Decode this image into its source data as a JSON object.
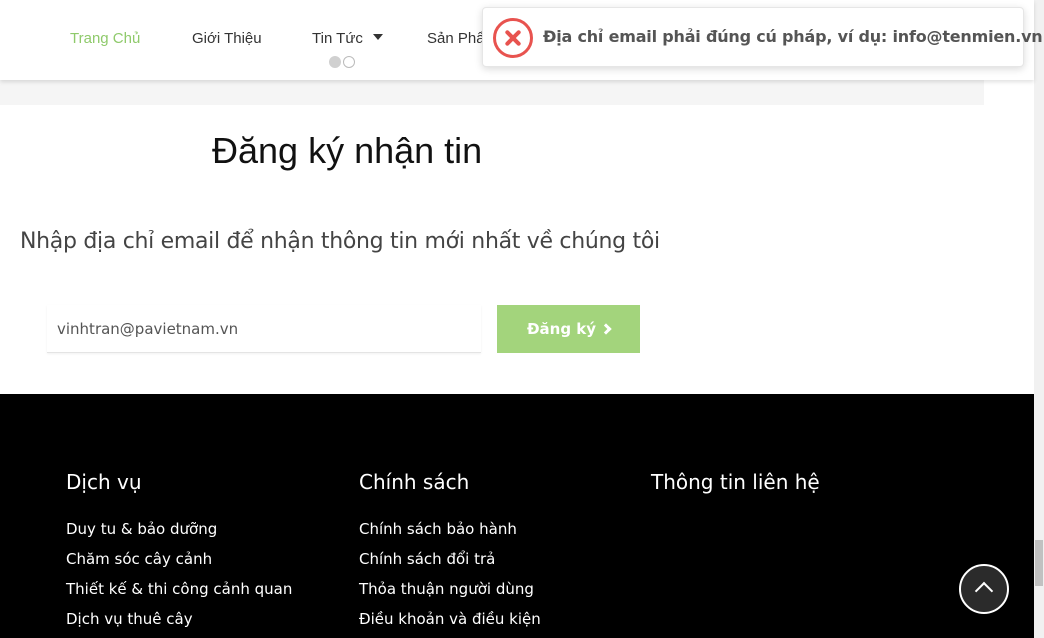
{
  "nav": {
    "items": [
      {
        "label": "Trang Chủ",
        "active": true
      },
      {
        "label": "Giới Thiệu"
      },
      {
        "label": "Tin Tức",
        "has_dropdown": true
      },
      {
        "label": "Sản Phẩ"
      }
    ]
  },
  "toast": {
    "type": "error",
    "icon": "error-x-icon",
    "message": "Địa chỉ email phải đúng cú pháp, ví dụ: info@tenmien.vn!"
  },
  "newsletter": {
    "title": "Đăng ký nhận tin",
    "description": "Nhập địa chỉ email để nhận thông tin mới nhất về chúng tôi",
    "email_value": "vinhtran@pavietnam.vn",
    "submit_label": "Đăng ký"
  },
  "footer": {
    "columns": [
      {
        "title": "Dịch vụ",
        "links": [
          "Duy tu & bảo dưỡng",
          "Chăm sóc cây cảnh",
          "Thiết kế & thi công cảnh quan",
          "Dịch vụ thuê cây"
        ]
      },
      {
        "title": "Chính sách",
        "links": [
          "Chính sách bảo hành",
          "Chính sách đổi trả",
          "Thỏa thuận người dùng",
          "Điều khoản và điều kiện"
        ]
      },
      {
        "title": "Thông tin liên hệ",
        "links": []
      }
    ]
  },
  "colors": {
    "accent": "#8fca6b",
    "button": "#a3d47c",
    "error": "#e8534f",
    "footer_bg": "#000000"
  }
}
